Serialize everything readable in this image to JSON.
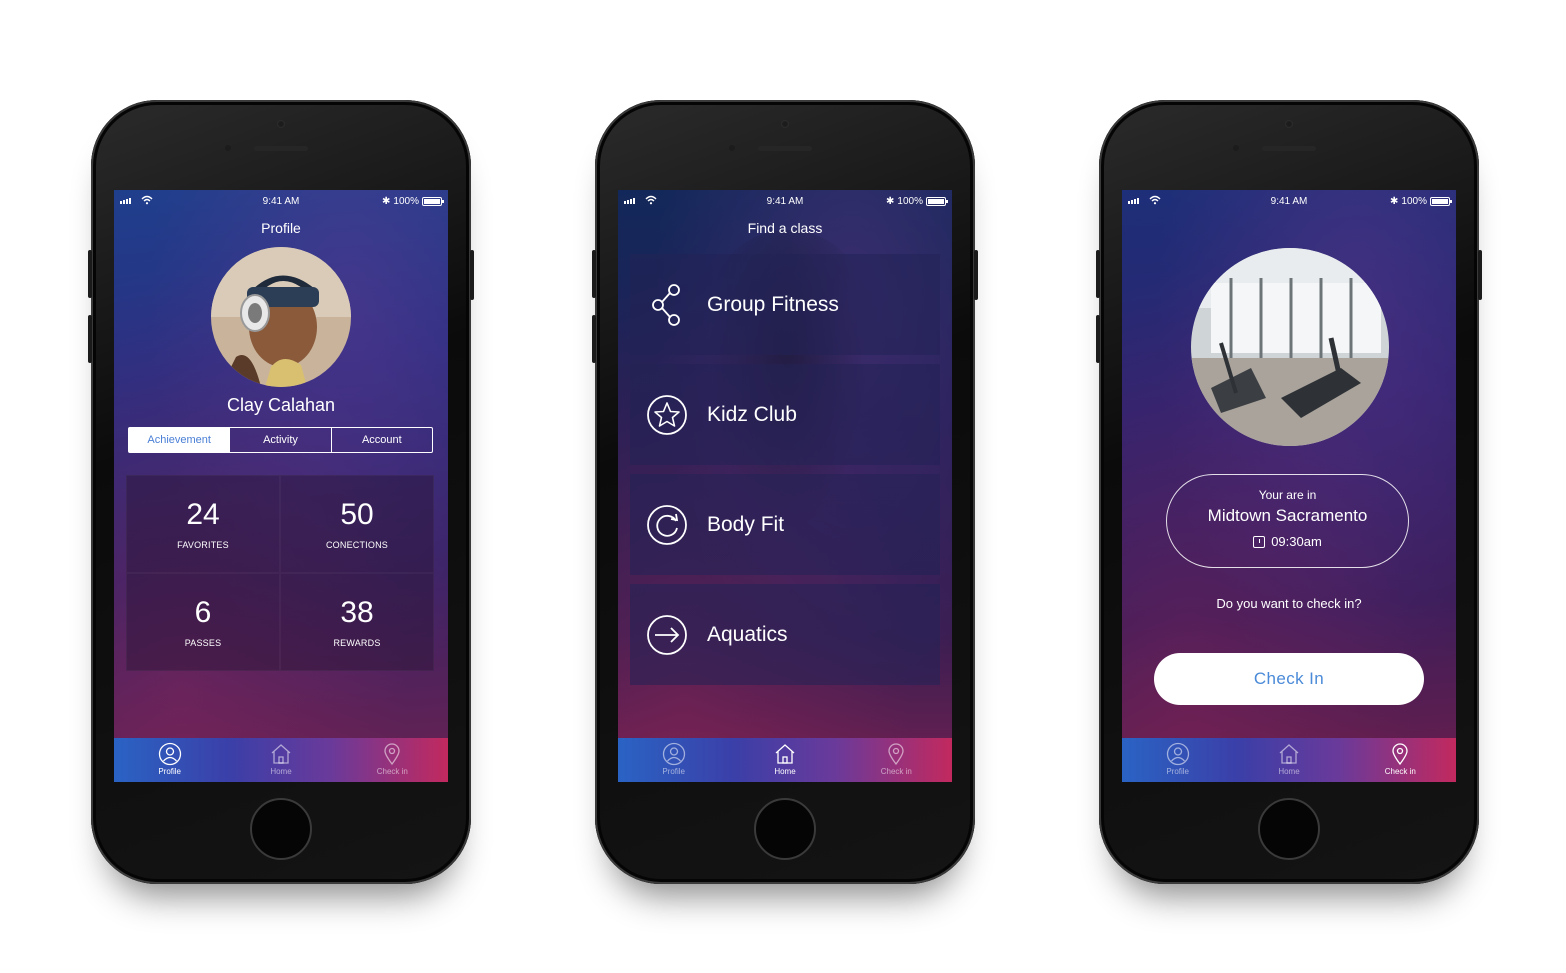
{
  "status_bar": {
    "time": "9:41 AM",
    "battery": "100%",
    "battery_level": 1.0,
    "bluetooth": "✱",
    "wifi": "wifi-icon"
  },
  "tab_bar": {
    "profile": "Profile",
    "home": "Home",
    "checkin": "Check in"
  },
  "colors": {
    "tab_gradient_start": "#2a63c4",
    "tab_gradient_end": "#c2295e",
    "accent_blue": "#4a7fd6"
  },
  "screen1": {
    "title": "Profile",
    "user_name": "Clay Calahan",
    "segments": [
      "Achievement",
      "Activity",
      "Account"
    ],
    "stats": [
      {
        "value": "24",
        "label": "FAVORITES"
      },
      {
        "value": "50",
        "label": "CONECTIONS"
      },
      {
        "value": "6",
        "label": "PASSES"
      },
      {
        "value": "38",
        "label": "REWARDS"
      }
    ]
  },
  "screen2": {
    "title": "Find a class",
    "classes": [
      {
        "name": "Group Fitness",
        "icon": "share-icon"
      },
      {
        "name": "Kidz Club",
        "icon": "star-icon"
      },
      {
        "name": "Body Fit",
        "icon": "refresh-icon"
      },
      {
        "name": "Aquatics",
        "icon": "arrow-right-icon"
      }
    ]
  },
  "screen3": {
    "location_intro": "Your are in",
    "location_name": "Midtown Sacramento",
    "time": "09:30am",
    "question": "Do you want to check in?",
    "button": "Check In"
  }
}
